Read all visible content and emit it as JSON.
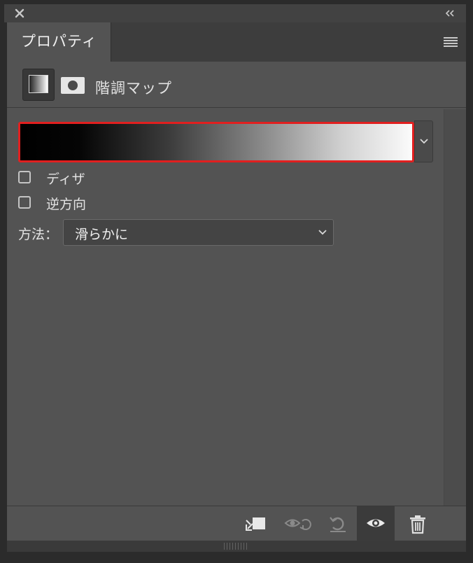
{
  "panel": {
    "tab_label": "プロパティ",
    "adjustment_title": "階調マップ"
  },
  "icons": {
    "close": "close-icon",
    "collapse": "double-chevron-left-icon",
    "panel_menu": "hamburger-menu-icon",
    "adjustment": "gradient-map-icon",
    "mask": "layer-mask-icon",
    "dropdown": "chevron-down-icon",
    "clip": "clip-to-layer-icon",
    "view_previous": "view-previous-state-icon",
    "reset": "reset-icon",
    "visibility": "eye-icon",
    "delete": "trash-icon"
  },
  "gradient": {
    "start_color": "#000000",
    "end_color": "#FFFFFF",
    "highlight_color": "#E11F1F"
  },
  "options": {
    "dither_label": "ディザ",
    "dither_checked": false,
    "reverse_label": "逆方向",
    "reverse_checked": false
  },
  "method": {
    "label": "方法：",
    "selected": "滑らかに"
  }
}
